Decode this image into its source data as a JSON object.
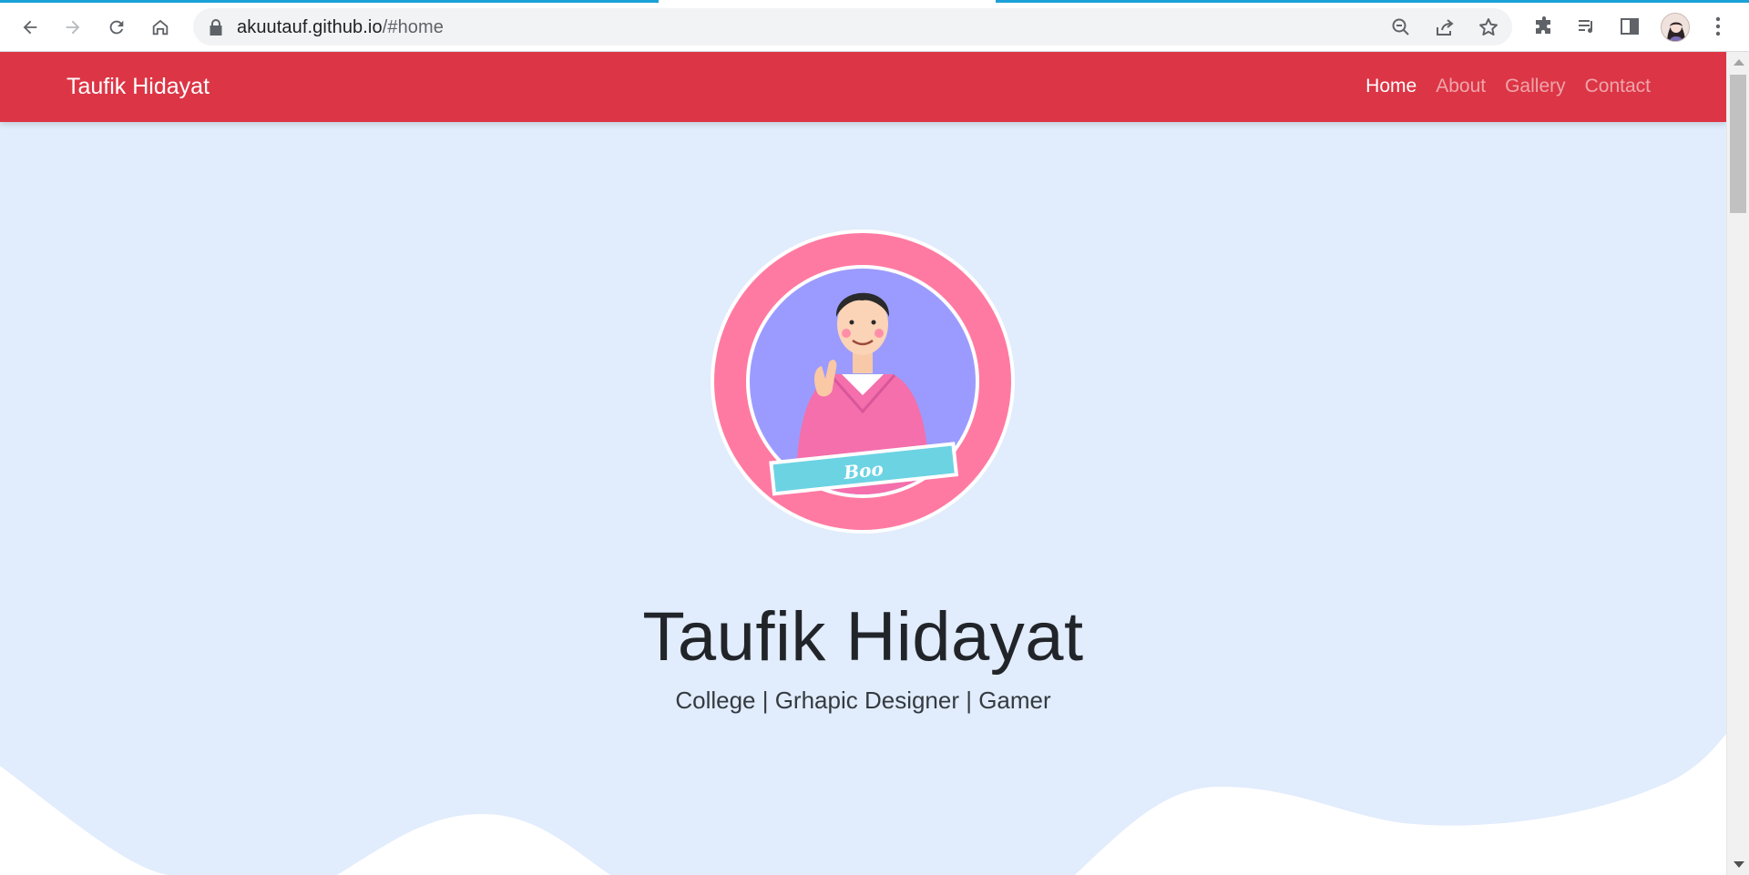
{
  "browser": {
    "url_host": "akuutauf.github.io",
    "url_path": "/#home",
    "icons": {
      "back": "arrow-left-icon",
      "forward": "arrow-right-icon",
      "reload": "reload-icon",
      "home": "home-icon",
      "lock": "lock-icon",
      "zoom": "zoom-out-icon",
      "share": "share-icon",
      "bookmark": "star-icon",
      "extensions": "puzzle-icon",
      "media": "media-queue-icon",
      "side_panel": "side-panel-icon",
      "profile": "profile-avatar",
      "menu": "kebab-menu-icon"
    }
  },
  "navbar": {
    "brand": "Taufik Hidayat",
    "links": [
      {
        "label": "Home",
        "active": true
      },
      {
        "label": "About",
        "active": false
      },
      {
        "label": "Gallery",
        "active": false
      },
      {
        "label": "Contact",
        "active": false
      }
    ]
  },
  "hero": {
    "avatar_badge": "Boo",
    "name": "Taufik Hidayat",
    "tagline": "College | Grhapic Designer | Gamer"
  },
  "colors": {
    "navbar": "#dc3545",
    "jumbotron": "#e1ecfc",
    "avatar_ring": "#ff7aa2",
    "avatar_inner": "#9b9bff",
    "badge": "#6cd3e3"
  }
}
